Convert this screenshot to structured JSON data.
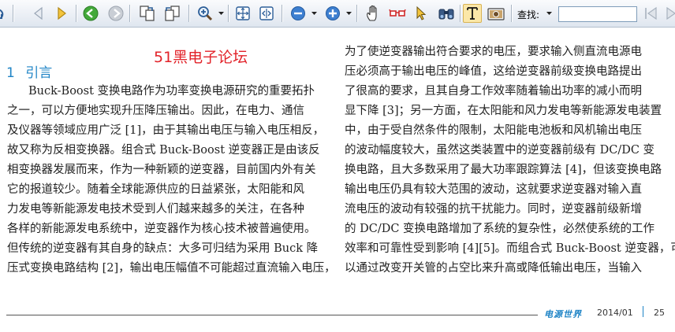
{
  "toolbar": {
    "search_label": "查找:",
    "search_value": ""
  },
  "document": {
    "watermark": "51黑电子论坛",
    "section_number": "1",
    "section_title": "引言",
    "left_column": [
      "Buck-Boost 变换电路作为功率变换电源研究的重要拓扑",
      "之一，可以方便地实现升压降压输出。因此，在电力、通信",
      "及仪器等领域应用广泛 [1]，由于其输出电压与输入电压相反，",
      "故又称为反相变换器。组合式 Buck-Boost 逆变器正是由该反",
      "相变换器发展而来，作为一种新颖的逆变器，目前国内外有关",
      "它的报道较少。随着全球能源供应的日益紧张，太阳能和风",
      "力发电等新能源发电技术受到人们越来越多的关注，在各种",
      "各样的新能源发电系统中，逆变器作为核心技术被普遍使用。",
      "但传统的逆变器有其自身的缺点：大多可归结为采用 Buck 降",
      "压式变换电路结构 [2]，输出电压幅值不可能超过直流输入电压，"
    ],
    "right_column": [
      "为了使逆变器输出符合要求的电压，要求输入侧直流电源电",
      "压必须高于输出电压的峰值，这给逆变器前级变换电路提出",
      "了很高的要求，且其自身工作效率随着输出功率的减小而明",
      "显下降 [3]；另一方面，在太阳能和风力发电等新能源发电装置",
      "中，由于受自然条件的限制，太阳能电池板和风机输出电压",
      "的波动幅度较大，虽然这类装置中的逆变器前级有 DC/DC 变",
      "换电路，且大多数采用了最大功率跟踪算法 [4]，但该变换电路",
      "输出电压仍具有较大范围的波动，这就要求逆变器对输入直",
      "流电压的波动有较强的抗干扰能力。同时，逆变器前级新增",
      "的 DC/DC 变换电路增加了系统的复杂性，必然使系统的工作",
      "效率和可靠性受到影响 [4][5]。而组合式 Buck-Boost 逆变器，可",
      "以通过改变开关管的占空比来升高或降低输出电压，当输入"
    ],
    "footer": {
      "journal": "电源世界",
      "date": "2014/01",
      "page": "25"
    }
  }
}
